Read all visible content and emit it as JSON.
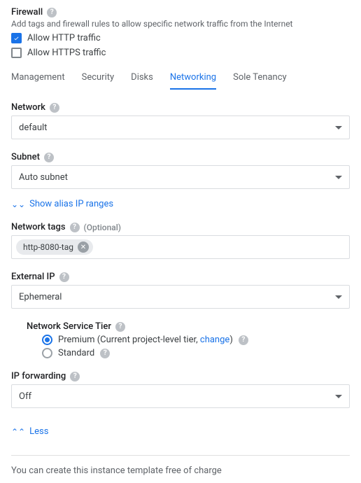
{
  "firewall": {
    "heading": "Firewall",
    "description": "Add tags and firewall rules to allow specific network traffic from the Internet",
    "http_label": "Allow HTTP traffic",
    "https_label": "Allow HTTPS traffic",
    "http_checked": true,
    "https_checked": false
  },
  "tabs": {
    "management": "Management",
    "security": "Security",
    "disks": "Disks",
    "networking": "Networking",
    "sole_tenancy": "Sole Tenancy"
  },
  "network": {
    "label": "Network",
    "value": "default"
  },
  "subnet": {
    "label": "Subnet",
    "value": "Auto subnet"
  },
  "alias_toggle": "Show alias IP ranges",
  "network_tags": {
    "label": "Network tags",
    "optional": "(Optional)",
    "chip": "http-8080-tag"
  },
  "external_ip": {
    "label": "External IP",
    "value": "Ephemeral"
  },
  "nst": {
    "label": "Network Service Tier",
    "premium_prefix": "Premium (Current project-level tier, ",
    "premium_link": "change",
    "premium_suffix": ")",
    "standard": "Standard"
  },
  "ip_forwarding": {
    "label": "IP forwarding",
    "value": "Off"
  },
  "less_toggle": "Less",
  "footnote": "You can create this instance template free of charge"
}
